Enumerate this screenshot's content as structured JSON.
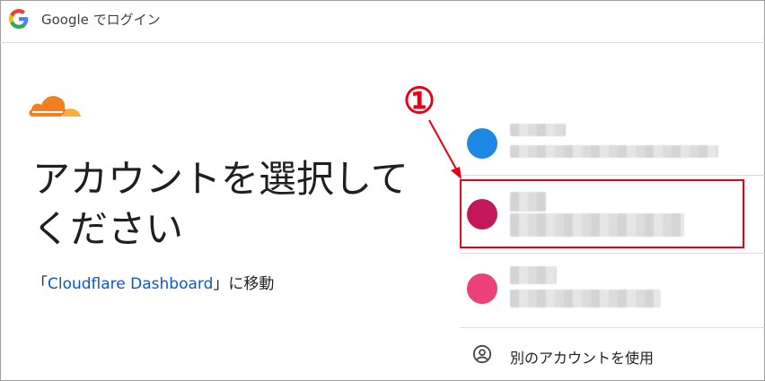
{
  "header": {
    "title": "Google でログイン"
  },
  "main": {
    "headline_line1": "アカウントを選択して",
    "headline_line2": "ください",
    "continue_prefix": "「",
    "app_name": "Cloudflare Dashboard",
    "continue_suffix": "」に移動"
  },
  "accounts": [
    {
      "avatar_color": "#1e88e5"
    },
    {
      "avatar_color": "#c2185b"
    },
    {
      "avatar_color": "#ec407a"
    }
  ],
  "other_account": {
    "label": "別のアカウントを使用",
    "icon": "person-circle-icon"
  },
  "annotation": {
    "number": "①",
    "color": "#e60012"
  },
  "colors": {
    "link": "#0b57d0",
    "cloudflare_orange": "#f38020"
  }
}
